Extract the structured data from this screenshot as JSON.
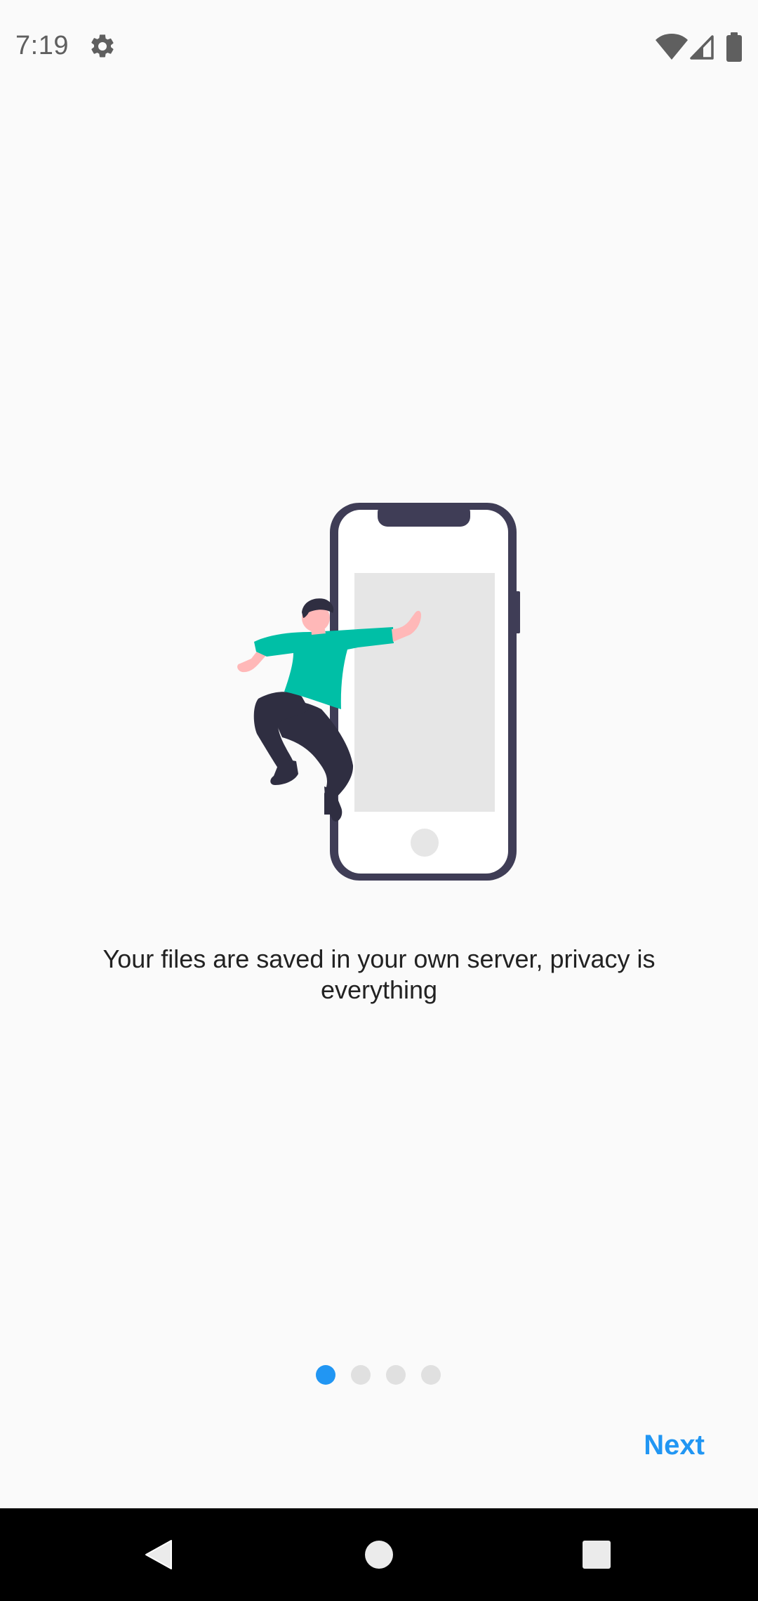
{
  "status_bar": {
    "time": "7:19",
    "icons": [
      "gear-icon",
      "wifi-icon",
      "signal-icon",
      "battery-icon"
    ]
  },
  "onboarding": {
    "message": "Your files are saved in your own server, privacy is everything",
    "illustration": "person-with-phone-illustration",
    "page_indicator": {
      "total": 4,
      "active_index": 0
    },
    "next_label": "Next"
  },
  "colors": {
    "accent": "#2196f3",
    "background": "#fafafa",
    "phone_frame": "#3f3d56",
    "shirt": "#00bfa6",
    "dot_inactive": "#e0e0e0"
  },
  "nav_bar": {
    "buttons": [
      "back-icon",
      "home-icon",
      "recents-icon"
    ]
  }
}
